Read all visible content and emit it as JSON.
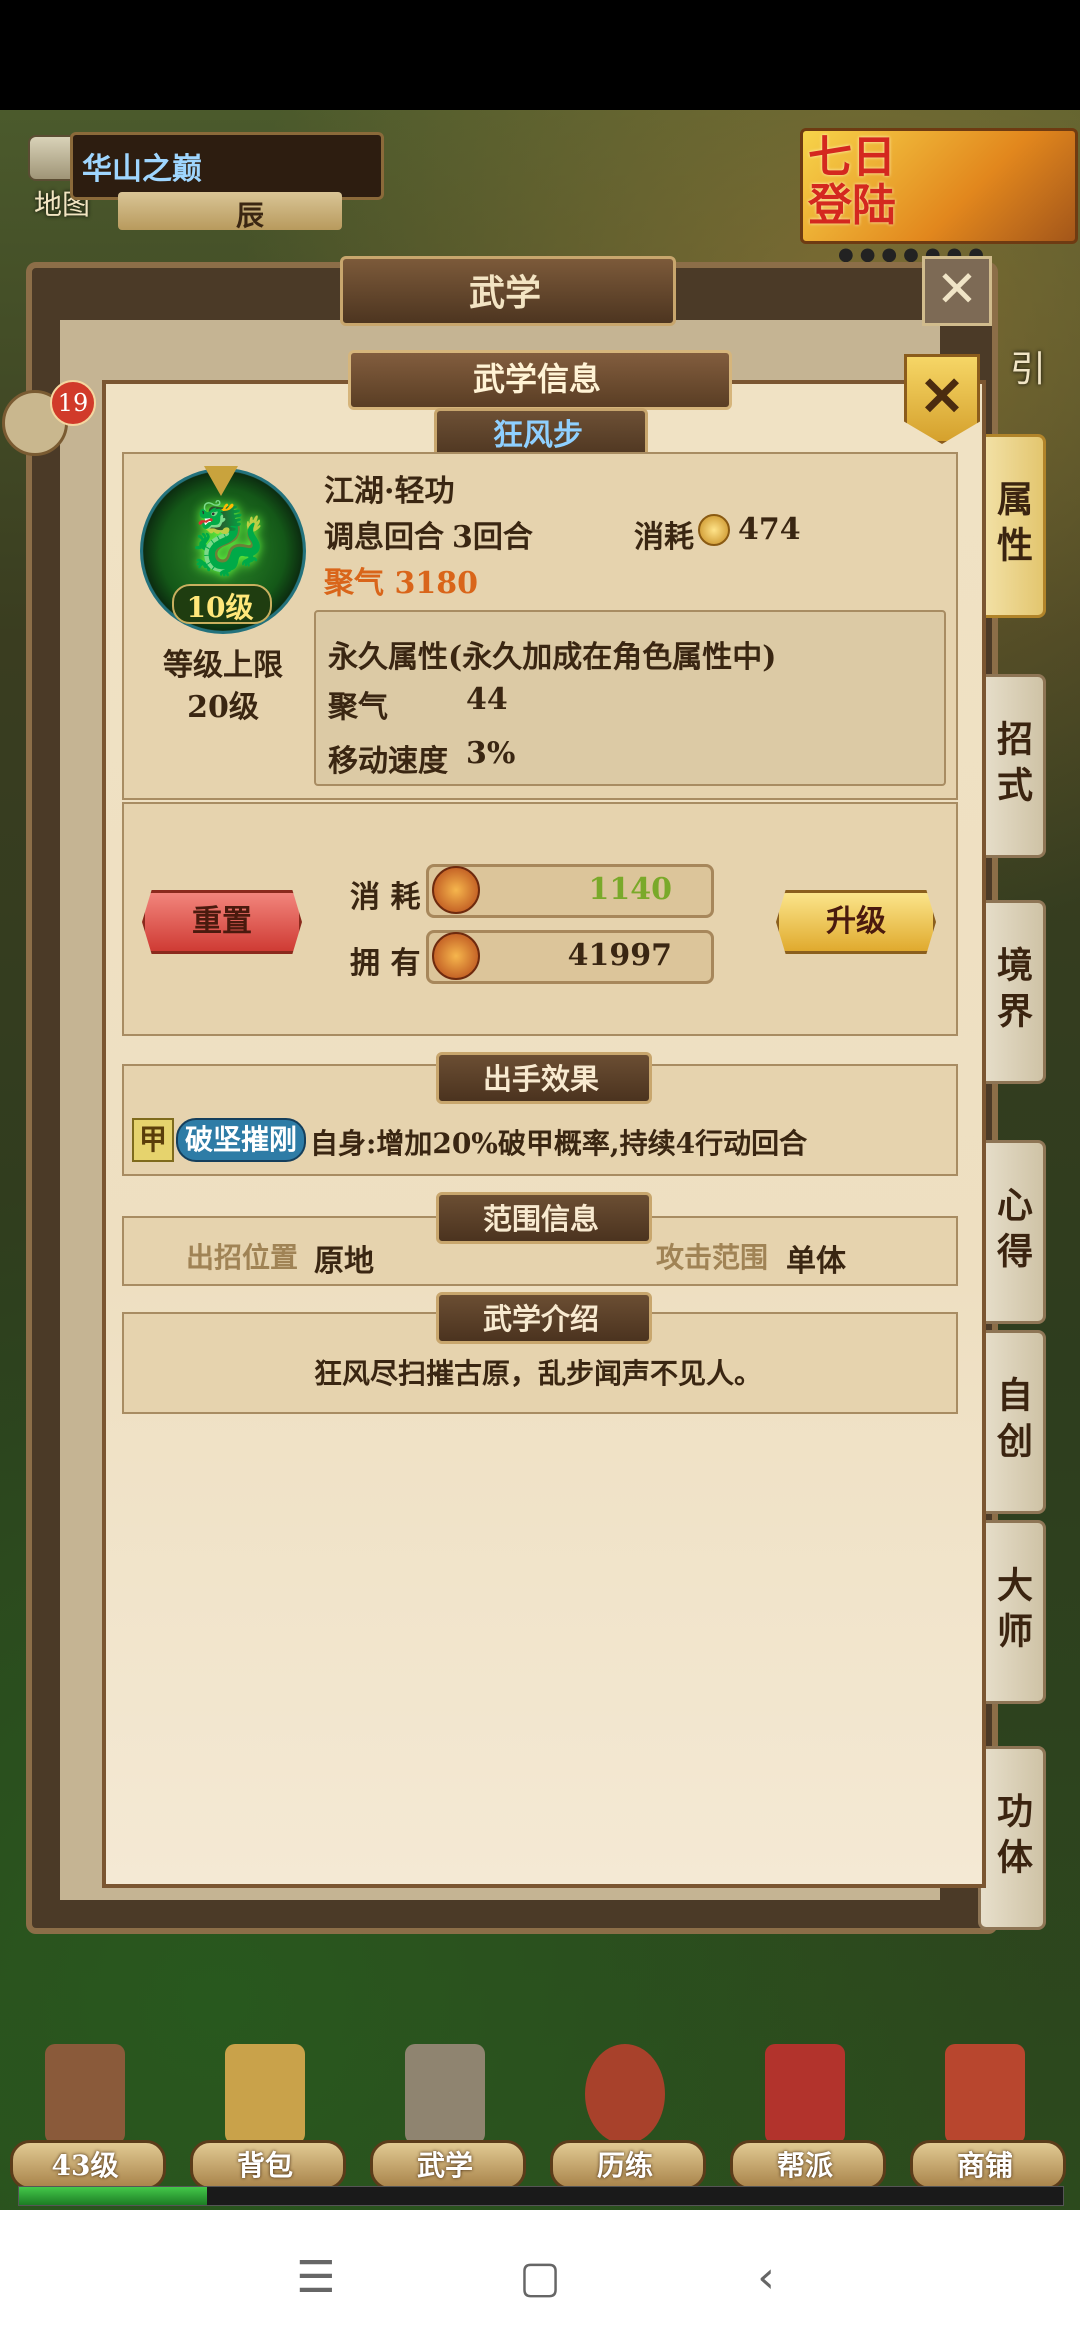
{
  "hud": {
    "map_label": "地图",
    "location": "华山之巅",
    "time": "辰",
    "event_banner": "七日登陆",
    "guide_label": "引",
    "chat_badge": "19"
  },
  "background_panel": {
    "title": "武学"
  },
  "side_tabs": [
    {
      "label": "属性",
      "active": true
    },
    {
      "label": "招式",
      "active": false
    },
    {
      "label": "境界",
      "active": false
    },
    {
      "label": "心得",
      "active": false
    },
    {
      "label": "自创",
      "active": false
    },
    {
      "label": "大师",
      "active": false
    },
    {
      "label": "功体",
      "active": false
    }
  ],
  "dialog": {
    "title": "武学信息",
    "skill_name": "狂风步",
    "skill_level": "10级",
    "level_cap_label": "等级上限",
    "level_cap_value": "20级",
    "category": "江湖·轻功",
    "breath_label": "调息回合",
    "breath_value": "3回合",
    "cost_label": "消耗",
    "cost_value": "474",
    "qi_text": "聚气 3180",
    "perm_title": "永久属性(永久加成在角色属性中)",
    "perm_stats": [
      {
        "name": "聚气",
        "value": "44"
      },
      {
        "name": "移动速度",
        "value": "3%"
      }
    ],
    "reset_button": "重置",
    "upgrade_button": "升级",
    "resources": {
      "cost_label": "消 耗",
      "cost_value": "1140",
      "own_label": "拥 有",
      "own_value": "41997"
    },
    "effect_section": "出手效果",
    "effect_tag": "甲",
    "effect_skill": "破坚摧刚",
    "effect_text": "自身:增加20%破甲概率,持续4行动回合",
    "range_section": "范围信息",
    "position_label": "出招位置",
    "position_value": "原地",
    "range_label": "攻击范围",
    "range_value": "单体",
    "intro_section": "武学介绍",
    "intro_text": "狂风尽扫摧古原，乱步闻声不见人。"
  },
  "bottom_nav": [
    {
      "label": "43级",
      "icon": "character-icon",
      "color": "#8a5a3a"
    },
    {
      "label": "背包",
      "icon": "bag-icon",
      "color": "#c9a24a"
    },
    {
      "label": "武学",
      "icon": "martial-scroll-icon",
      "color": "#8f8470"
    },
    {
      "label": "历练",
      "icon": "drum-icon",
      "color": "#a8412b"
    },
    {
      "label": "帮派",
      "icon": "banner-icon",
      "color": "#b2332c"
    },
    {
      "label": "商铺",
      "icon": "shop-icon",
      "color": "#b8462e"
    }
  ],
  "exp_progress": 0.18,
  "colors": {
    "qi_text": "#d9651a",
    "resource_cost": "#7aa92a",
    "accent_gold": "#e0aa2e"
  },
  "system_nav": {
    "menu_icon": "menu-icon",
    "home_icon": "home-icon",
    "back_icon": "back-icon"
  }
}
